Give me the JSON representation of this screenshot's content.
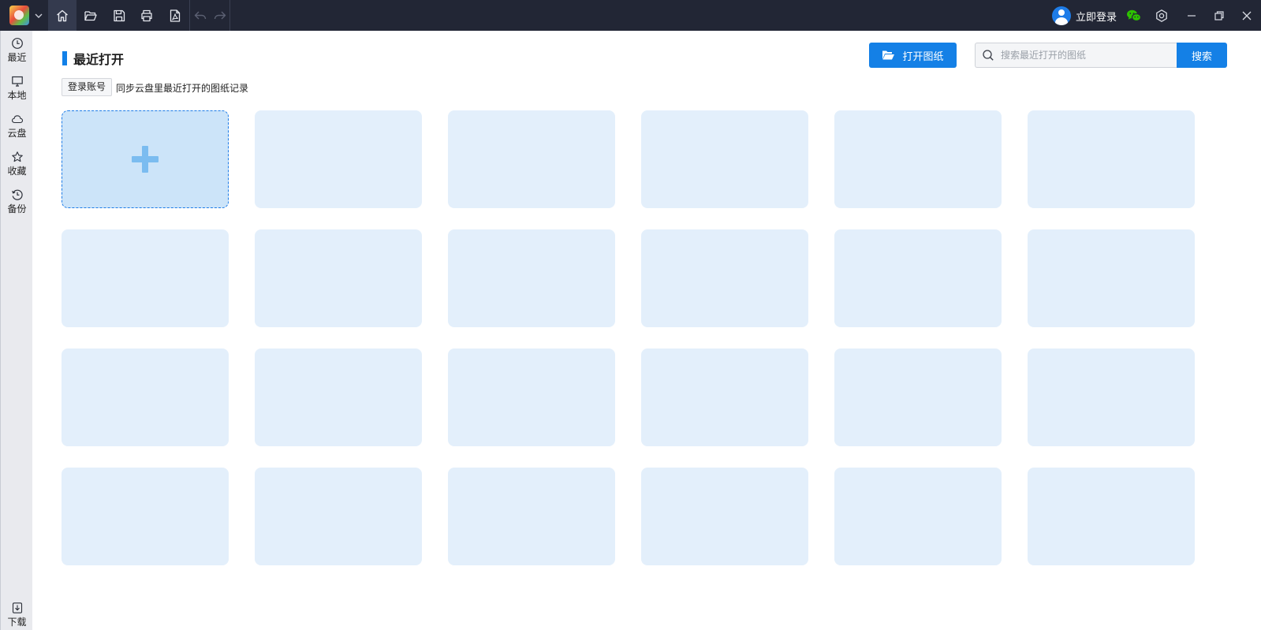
{
  "titlebar": {
    "toolbar": [
      {
        "name": "home-icon",
        "active": true
      },
      {
        "name": "open-folder-icon",
        "active": false
      },
      {
        "name": "save-icon",
        "active": false
      },
      {
        "name": "print-icon",
        "active": false
      },
      {
        "name": "pdf-icon",
        "active": false
      },
      {
        "name": "undo-icon",
        "active": false
      },
      {
        "name": "redo-icon",
        "active": false
      }
    ],
    "login_label": "立即登录"
  },
  "sidebar": {
    "items": [
      {
        "label": "最近",
        "icon": "clock-icon"
      },
      {
        "label": "本地",
        "icon": "monitor-icon"
      },
      {
        "label": "云盘",
        "icon": "cloud-icon"
      },
      {
        "label": "收藏",
        "icon": "star-icon"
      },
      {
        "label": "备份",
        "icon": "history-icon"
      }
    ],
    "download_label": "下载"
  },
  "main": {
    "section_title": "最近打开",
    "login_account_label": "登录账号",
    "sync_text": "同步云盘里最近打开的图纸记录",
    "open_drawing_label": "打开图纸",
    "search": {
      "placeholder": "搜索最近打开的图纸",
      "button_label": "搜索"
    },
    "grid": {
      "columns": 6,
      "rows": 4,
      "add_card_icon": "plus-icon"
    }
  },
  "colors": {
    "titlebar_bg": "#222635",
    "accent": "#1480e6",
    "card_bg": "#e3effb",
    "add_card_bg": "#cce4f9",
    "sidebar_bg": "#e9eaee",
    "wechat_green": "#2dc100"
  }
}
